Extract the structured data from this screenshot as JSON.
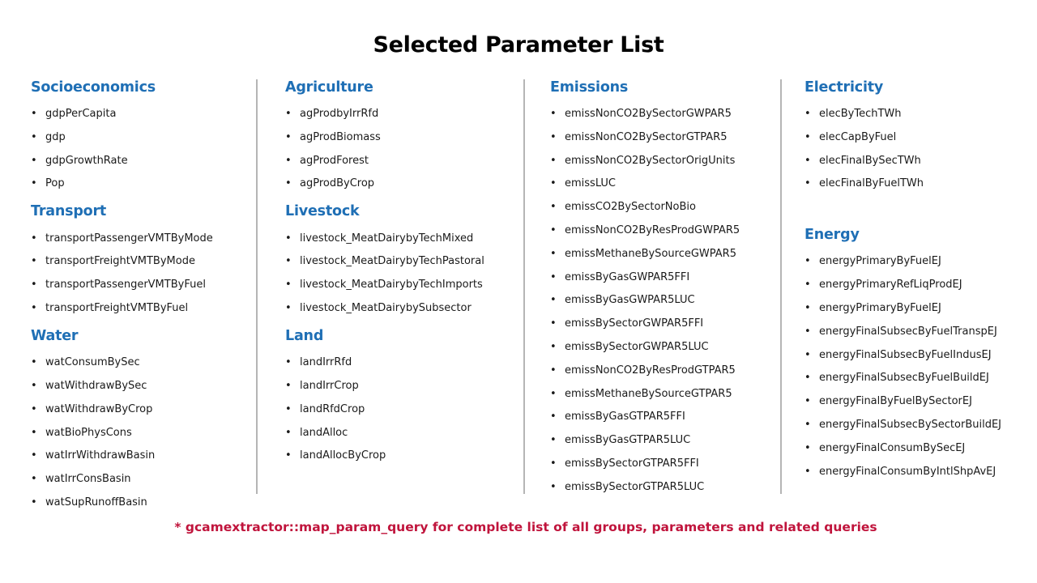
{
  "title": "Selected Parameter List",
  "footnote": "* gcamextractor::map_param_query for complete list of all groups, parameters and related queries",
  "columns": [
    {
      "sections": [
        {
          "title": "Socioeconomics",
          "items": [
            "gdpPerCapita",
            "gdp",
            "gdpGrowthRate",
            "Pop"
          ]
        },
        {
          "title": "Transport",
          "items": [
            "transportPassengerVMTByMode",
            "transportFreightVMTByMode",
            "transportPassengerVMTByFuel",
            "transportFreightVMTByFuel"
          ]
        },
        {
          "title": "Water",
          "items": [
            "watConsumBySec",
            "watWithdrawBySec",
            "watWithdrawByCrop",
            "watBioPhysCons",
            "watIrrWithdrawBasin",
            "watIrrConsBasin",
            "watSupRunoffBasin"
          ]
        }
      ]
    },
    {
      "sections": [
        {
          "title": "Agriculture",
          "items": [
            "agProdbyIrrRfd",
            "agProdBiomass",
            "agProdForest",
            "agProdByCrop"
          ]
        },
        {
          "title": "Livestock",
          "items": [
            "livestock_MeatDairybyTechMixed",
            "livestock_MeatDairybyTechPastoral",
            "livestock_MeatDairybyTechImports",
            "livestock_MeatDairybySubsector"
          ]
        },
        {
          "title": "Land",
          "items": [
            "landIrrRfd",
            "landIrrCrop",
            "landRfdCrop",
            "landAlloc",
            "landAllocByCrop"
          ]
        }
      ]
    },
    {
      "sections": [
        {
          "title": "Emissions",
          "items": [
            "emissNonCO2BySectorGWPAR5",
            "emissNonCO2BySectorGTPAR5",
            "emissNonCO2BySectorOrigUnits",
            "emissLUC",
            "emissCO2BySectorNoBio",
            "emissNonCO2ByResProdGWPAR5",
            "emissMethaneBySourceGWPAR5",
            "emissByGasGWPAR5FFI",
            "emissByGasGWPAR5LUC",
            "emissBySectorGWPAR5FFI",
            "emissBySectorGWPAR5LUC",
            "emissNonCO2ByResProdGTPAR5",
            "emissMethaneBySourceGTPAR5",
            "emissByGasGTPAR5FFI",
            "emissByGasGTPAR5LUC",
            "emissBySectorGTPAR5FFI",
            "emissBySectorGTPAR5LUC"
          ]
        }
      ]
    },
    {
      "sections": [
        {
          "title": "Electricity",
          "items": [
            "elecByTechTWh",
            "elecCapByFuel",
            "elecFinalBySecTWh",
            "elecFinalByFuelTWh"
          ]
        },
        {
          "title": "Energy",
          "items": [
            "energyPrimaryByFuelEJ",
            "energyPrimaryRefLiqProdEJ",
            "energyPrimaryByFuelEJ",
            "energyFinalSubsecByFuelTranspEJ",
            "energyFinalSubsecByFuelIndusEJ",
            "energyFinalSubsecByFuelBuildEJ",
            "energyFinalByFuelBySectorEJ",
            "energyFinalSubsecBySectorBuildEJ",
            "energyFinalConsumBySecEJ",
            "energyFinalConsumByIntlShpAvEJ"
          ]
        }
      ]
    }
  ]
}
